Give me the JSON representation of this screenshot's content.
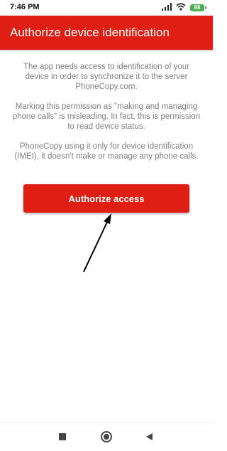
{
  "status_bar": {
    "time": "7:46 PM",
    "battery_level": "88",
    "icons": [
      "signal-icon",
      "wifi-icon",
      "battery-icon"
    ]
  },
  "app_bar": {
    "title": "Authorize device identification",
    "background_color": "#e01f14"
  },
  "content": {
    "paragraph_1": "The app needs access to identification of your device in order to synchronize it to the server PhoneCopy.com.",
    "paragraph_2": "Marking this permission as \"making and managing phone calls\" is misleading. In fact, this is permission to read device status.",
    "paragraph_3": "PhoneCopy using it only for device identification (IMEI), it doesn't make or manage any phone calls."
  },
  "authorize_button": {
    "label": "Authorize access",
    "color": "#e01f14"
  },
  "annotation": {
    "icon": "arrow-icon",
    "color": "#000000"
  },
  "nav_bar": {
    "buttons": [
      "recents-square-icon",
      "home-circle-icon",
      "back-triangle-icon"
    ]
  }
}
